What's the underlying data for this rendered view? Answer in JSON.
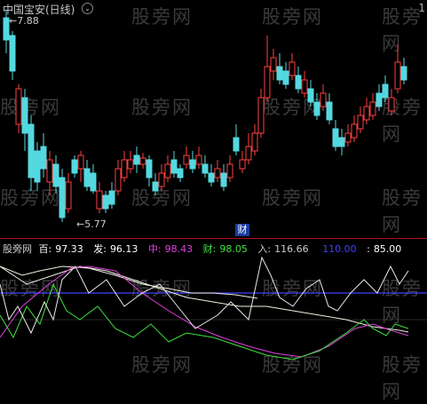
{
  "title": "中国宝安(日线)",
  "collapse_icon": "⌄",
  "corner_label": "1",
  "price_high_label": "7.88",
  "price_low_label": "5.77",
  "cai_badge": "财",
  "watermark": "股旁网",
  "colors": {
    "up": "#ff4040",
    "down": "#54d8e0",
    "white": "#ffffff",
    "magenta": "#e040e0",
    "green": "#40e040",
    "blue": "#4040ff",
    "divider": "#b01010"
  },
  "indicator": {
    "name": "股旁网",
    "items": [
      {
        "label": "百:",
        "value": "97.33",
        "color": "#ffffff"
      },
      {
        "label": "发:",
        "value": "96.13",
        "color": "#ffffff"
      },
      {
        "label": "中:",
        "value": "98.43",
        "color": "#e040e0"
      },
      {
        "label": "财:",
        "value": "98.05",
        "color": "#40e040"
      },
      {
        "label": "入:",
        "value": "116.66",
        "color": "#cccccc"
      },
      {
        "label": "",
        "value": "110.00",
        "color": "#4040ff"
      },
      {
        "label": ":",
        "value": "85.00",
        "color": "#ffffff"
      }
    ]
  }
}
